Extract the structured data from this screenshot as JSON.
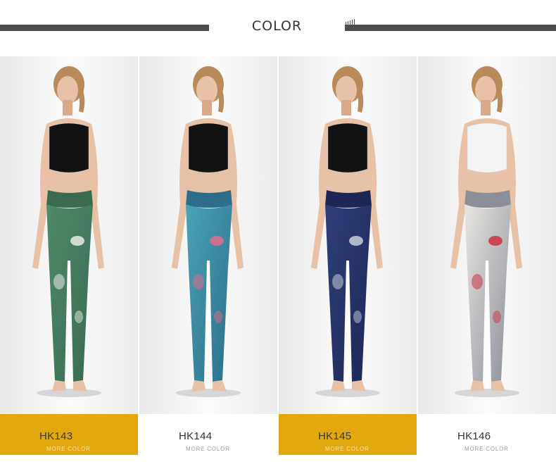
{
  "header": {
    "title": "COLOR"
  },
  "products": [
    {
      "code": "HK143",
      "more": "MORE COLOR",
      "highlight": true,
      "legging": "#4f8a6a",
      "legging_dark": "#3a6a50",
      "accent": "#e8ebe4",
      "top": "#111111"
    },
    {
      "code": "HK144",
      "more": "MORE COLOR",
      "highlight": false,
      "legging": "#4aa3b6",
      "legging_dark": "#2c6e8a",
      "accent": "#e06b8a",
      "top": "#111111"
    },
    {
      "code": "HK145",
      "more": "MORE COLOR",
      "highlight": true,
      "legging": "#2f3f7a",
      "legging_dark": "#1e2656",
      "accent": "#c9ccd8",
      "top": "#111111"
    },
    {
      "code": "HK146",
      "more": "MORE COLOR",
      "highlight": false,
      "legging": "#e9e6e1",
      "legging_dark": "#8c8f9a",
      "accent": "#cc3344",
      "top": "#f4f4f4"
    }
  ],
  "colors": {
    "accent_gold": "#e3a80e",
    "bar_gray": "#4d4d4d"
  }
}
